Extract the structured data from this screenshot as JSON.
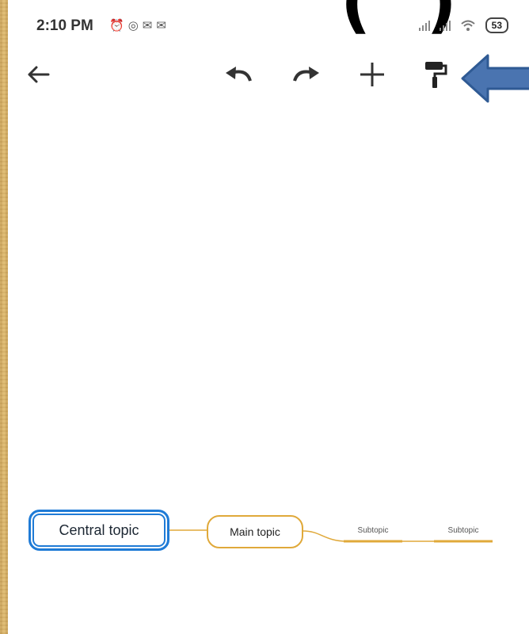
{
  "status_bar": {
    "time": "2:10 PM",
    "icons": [
      "alarm-icon",
      "whatsapp-icon",
      "gmail-icon",
      "gmail-icon"
    ],
    "battery": "53"
  },
  "toolbar": {
    "back": "back-arrow-icon",
    "undo": "undo-icon",
    "redo": "redo-icon",
    "add": "plus-icon",
    "format": "paint-roller-icon"
  },
  "mindmap": {
    "central_topic": "Central topic",
    "main_topic": "Main topic",
    "subtopics": [
      "Subtopic",
      "Subtopic"
    ]
  },
  "colors": {
    "central_border": "#1f7bd6",
    "branch": "#e0a93a",
    "annotation_arrow": "#4a74b0"
  }
}
